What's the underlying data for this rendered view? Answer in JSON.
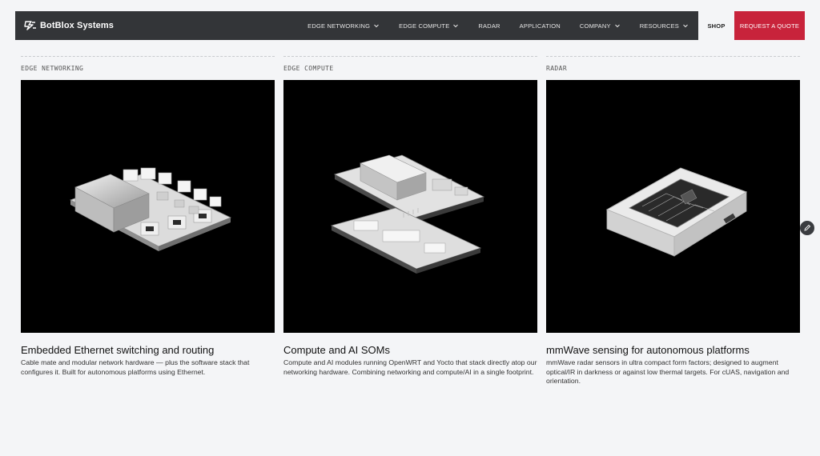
{
  "brand": {
    "name": "BotBlox Systems"
  },
  "nav": {
    "items": [
      {
        "label": "EDGE NETWORKING",
        "has_dropdown": true
      },
      {
        "label": "EDGE COMPUTE",
        "has_dropdown": true
      },
      {
        "label": "RADAR",
        "has_dropdown": false
      },
      {
        "label": "APPLICATION",
        "has_dropdown": false
      },
      {
        "label": "COMPANY",
        "has_dropdown": true
      },
      {
        "label": "RESOURCES",
        "has_dropdown": true
      }
    ],
    "shop": "SHOP",
    "quote": "REQUEST A QUOTE"
  },
  "colors": {
    "nav_bg": "#333538",
    "accent": "#c8233b",
    "page_bg": "#f4f5f7"
  },
  "cards": [
    {
      "category": "EDGE NETWORKING",
      "title": "Embedded Ethernet switching and routing",
      "description": "Cable mate and modular network hardware — plus the software stack that configures it. Built for autonomous platforms using Ethernet."
    },
    {
      "category": "EDGE COMPUTE",
      "title": "Compute and AI SOMs",
      "description": "Compute and AI modules running OpenWRT and Yocto that stack directly atop our networking hardware. Combining networking and compute/AI in a single footprint."
    },
    {
      "category": "RADAR",
      "title": "mmWave sensing for autonomous platforms",
      "description": "mmWave radar sensors in ultra compact form factors; designed to augment optical/IR in darkness or against low thermal targets. For cUAS, navigation and orientation."
    }
  ],
  "icons": {
    "logo": "botblox-logo-icon",
    "dropdown": "chevron-down-icon",
    "edit": "pencil-icon"
  }
}
